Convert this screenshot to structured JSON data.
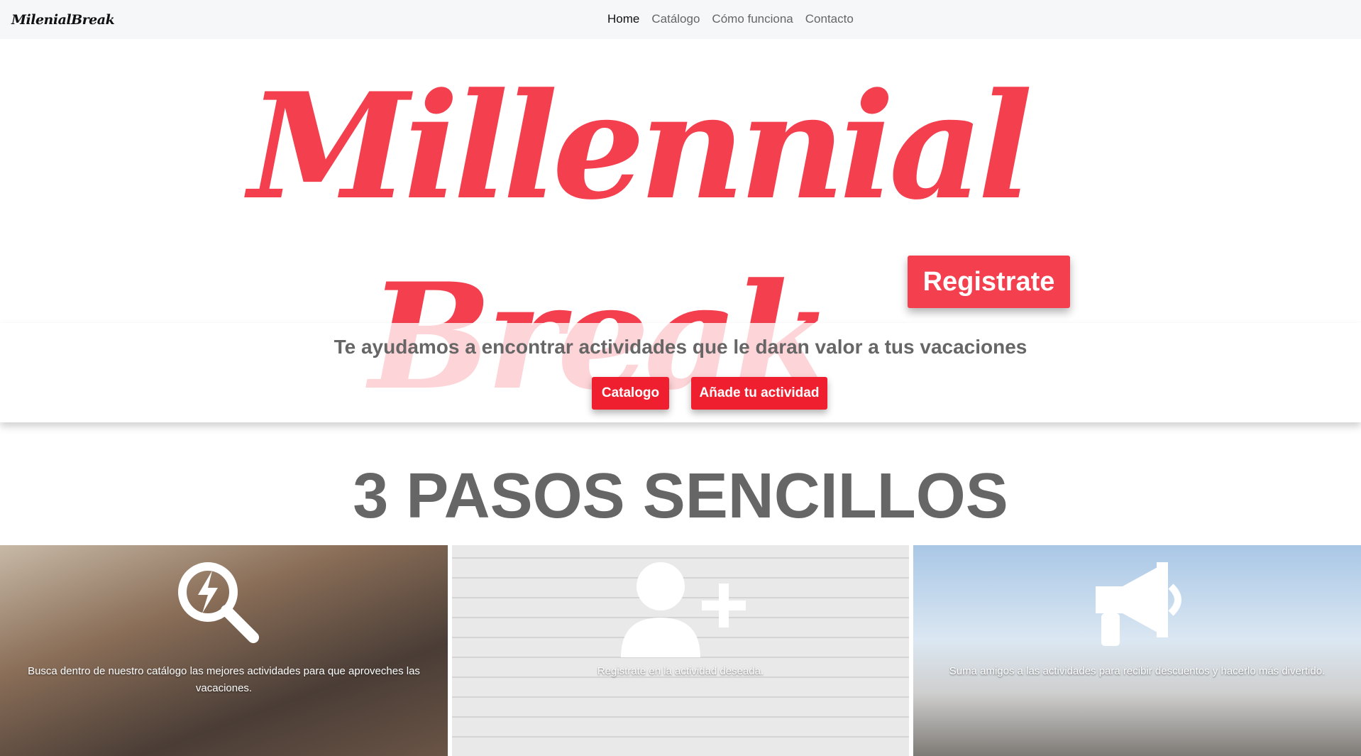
{
  "navbar": {
    "brand": "MilenialBreak",
    "links": [
      "Home",
      "Catálogo",
      "Cómo funciona",
      "Contacto"
    ],
    "active_link": "Home"
  },
  "hero": {
    "logo_line1": "Millennial",
    "logo_line2": "Break",
    "register_label": "Registrate",
    "tagline": "Te ayudamos a encontrar actividades que le daran valor a tus vacaciones",
    "cta_catalog_label": "Catalogo",
    "cta_add_label": "Añade tu actividad"
  },
  "steps": {
    "title": "3 PASOS SENCILLOS",
    "items": [
      {
        "icon": "search-bolt-icon",
        "caption": "Busca dentro de nuestro catálogo las mejores actividades para que aproveches las vacaciones."
      },
      {
        "icon": "add-user-icon",
        "caption": "Registrate en la actividad deseada."
      },
      {
        "icon": "megaphone-icon",
        "caption": "Suma amigos a las actividades para recibir descuentos y hacerlo más divertido."
      }
    ]
  },
  "colors": {
    "brand_red": "#f43f4f",
    "cta_red": "#ef1f2f",
    "heading_gray": "#666666"
  }
}
